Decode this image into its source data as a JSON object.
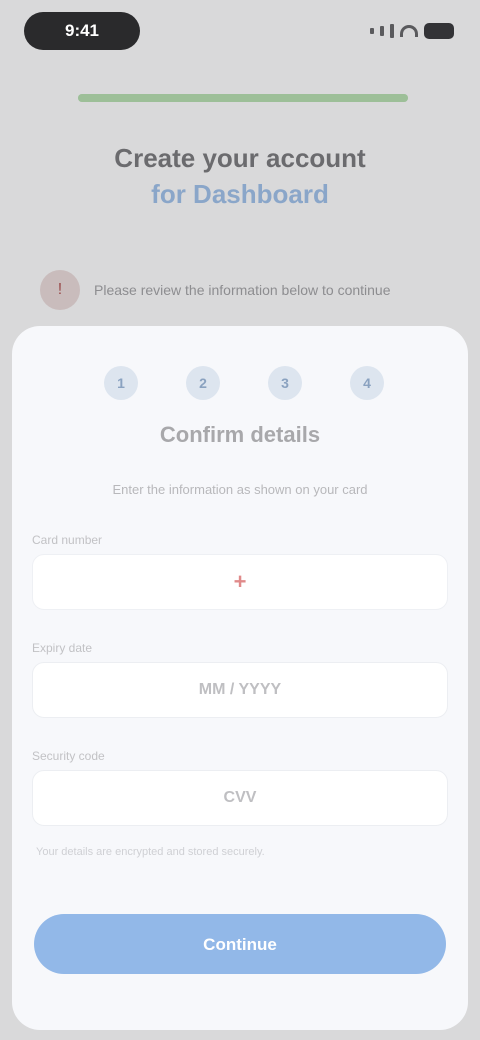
{
  "status_bar": {
    "time": "9:41"
  },
  "background": {
    "progress_fraction": 1.0,
    "title_line1": "Create your account",
    "title_line2_accent": "for Dashboard",
    "notice_icon": "alert-icon",
    "notice_text": "Please review the information below to continue"
  },
  "sheet": {
    "steps": [
      "1",
      "2",
      "3",
      "4"
    ],
    "title": "Confirm details",
    "subtitle": "Enter the information as shown on your card",
    "fields": [
      {
        "label": "Card number",
        "value": ""
      },
      {
        "label": "Expiry date",
        "value": "MM / YYYY"
      },
      {
        "label": "Security code",
        "value": "CVV"
      }
    ],
    "helper": "Your details are encrypted and stored securely.",
    "primary_button": "Continue"
  },
  "colors": {
    "accent": "#92b8e8",
    "progress": "#9dbf98",
    "sheet_bg": "#f7f8fb"
  }
}
